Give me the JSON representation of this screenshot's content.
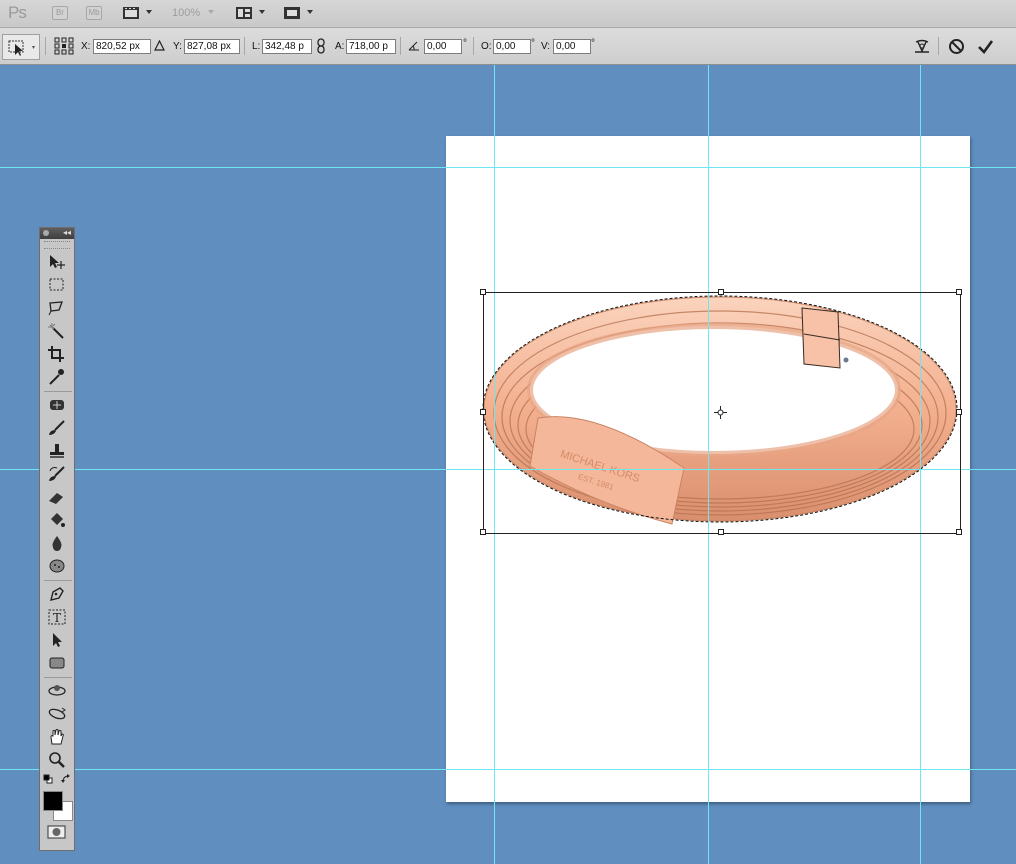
{
  "app": {
    "logo": "Ps",
    "bridge_label": "Br",
    "minibridge_label": "Mb",
    "zoom": "100%"
  },
  "options": {
    "x_label": "X:",
    "x_value": "820,52 px",
    "y_label": "Y:",
    "y_value": "827,08 px",
    "w_label": "L:",
    "w_value": "342,48 p",
    "h_label": "A:",
    "h_value": "718,00 p",
    "angle_value": "0,00",
    "angle_unit": "°",
    "hskew_label": "O:",
    "hskew_value": "0,00",
    "hskew_unit": "°",
    "vskew_label": "V:",
    "vskew_value": "0,00",
    "vskew_unit": "°"
  },
  "product": {
    "brand": "MICHAEL KORS",
    "est": "EST. 1981"
  },
  "colors": {
    "workspace": "#5f8ebf",
    "guide": "#6fe6f2",
    "bracelet": "#f4b496",
    "foreground": "#000000",
    "background": "#ffffff"
  },
  "tools": [
    "move-tool",
    "marquee-tool",
    "lasso-tool",
    "magic-wand-tool",
    "crop-tool",
    "eyedropper-tool",
    "spot-healing-tool",
    "brush-tool",
    "clone-stamp-tool",
    "history-brush-tool",
    "eraser-tool",
    "paint-bucket-tool",
    "blur-tool",
    "dodge-tool",
    "pen-tool",
    "type-tool",
    "path-selection-tool",
    "rectangle-tool",
    "3d-rotate-tool",
    "3d-orbit-tool",
    "hand-tool",
    "zoom-tool"
  ]
}
